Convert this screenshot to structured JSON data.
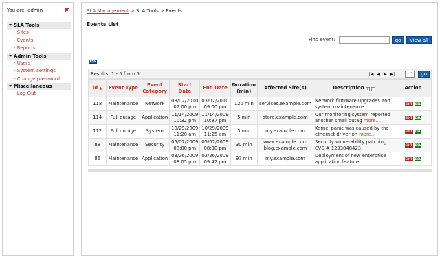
{
  "sidebar": {
    "user_label": "You are: admin",
    "groups": [
      {
        "label": "SLA Tools",
        "items": [
          "- Sites",
          "- Events",
          "- Reports"
        ]
      },
      {
        "label": "Admin Tools",
        "items": [
          "- Users",
          "- System settings",
          "- Change password"
        ]
      },
      {
        "label": "Miscellaneous",
        "items": [
          "- Log Out"
        ]
      }
    ]
  },
  "breadcrumb": {
    "item1": "SLA Management",
    "sep": ">",
    "item2": "SLA Tools",
    "item3": "Events"
  },
  "page_title": "Events List",
  "find": {
    "label": "Find event:",
    "value": "",
    "go_label": "go",
    "view_all_label": "view all"
  },
  "rss_label": "RSS",
  "results": {
    "text": "Results: 1 - 5 from 5",
    "first_glyph": "|◀",
    "prev_glyph": "◀",
    "next_glyph": "▶",
    "last_glyph": "▶|",
    "page_value": "1",
    "go_label": "go"
  },
  "table": {
    "headers": {
      "id": "id",
      "sort_glyph": "▲",
      "event_type": "Event Type",
      "event_category": "Event Category",
      "start_date": "Start Date",
      "end_date": "End Date",
      "duration": "Duration (min)",
      "affected": "Affected Site(s)",
      "description": "Description",
      "action": "Action"
    },
    "edit_label": "EDIT",
    "del_label": "DEL",
    "rows": [
      {
        "id": "118",
        "type": "Maintenance",
        "category": "Network",
        "start": "03/02/2010 07:00 pm",
        "end": "03/02/2010 09:00 pm",
        "duration": "120 min",
        "affected": "services.example.com",
        "description": "Network firmware upgrades and system maintenance",
        "more": ""
      },
      {
        "id": "114",
        "type": "Full outage",
        "category": "Application",
        "start": "11/14/2009 10:32 pm",
        "end": "11/14/2009 10:37 pm",
        "duration": "5 min",
        "affected": "store.example.com",
        "description": "Our monitoring system reported another small outag",
        "more": "more..."
      },
      {
        "id": "112",
        "type": "Full outage",
        "category": "System",
        "start": "10/29/2009 11:20 am",
        "end": "10/29/2009 11:25 am",
        "duration": "5 min",
        "affected": "my.example.com",
        "description": "Kernel panic was caused by the ethernet driver on",
        "more": "more..."
      },
      {
        "id": "88",
        "type": "Maintenance",
        "category": "Security",
        "start": "05/07/2009 08:00 pm",
        "end": "05/07/2009 08:30 pm",
        "duration": "30 min",
        "affected": "www.example.com blog.example.com",
        "description": "Security vulnerability patching. CVE # 1233848423",
        "more": ""
      },
      {
        "id": "86",
        "type": "Maintenance",
        "category": "Application",
        "start": "03/26/2009 08:05 pm",
        "end": "03/26/2009 09:42 pm",
        "duration": "97 min",
        "affected": "my.example.com",
        "description": "Deployment of new enterprise application feature.",
        "more": ""
      }
    ]
  }
}
